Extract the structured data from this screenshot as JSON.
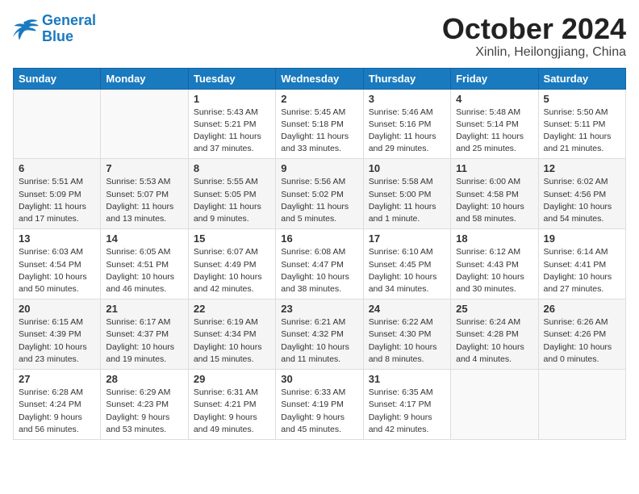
{
  "header": {
    "logo_line1": "General",
    "logo_line2": "Blue",
    "month": "October 2024",
    "location": "Xinlin, Heilongjiang, China"
  },
  "weekdays": [
    "Sunday",
    "Monday",
    "Tuesday",
    "Wednesday",
    "Thursday",
    "Friday",
    "Saturday"
  ],
  "weeks": [
    [
      {
        "day": "",
        "sunrise": "",
        "sunset": "",
        "daylight": ""
      },
      {
        "day": "",
        "sunrise": "",
        "sunset": "",
        "daylight": ""
      },
      {
        "day": "1",
        "sunrise": "Sunrise: 5:43 AM",
        "sunset": "Sunset: 5:21 PM",
        "daylight": "Daylight: 11 hours and 37 minutes."
      },
      {
        "day": "2",
        "sunrise": "Sunrise: 5:45 AM",
        "sunset": "Sunset: 5:18 PM",
        "daylight": "Daylight: 11 hours and 33 minutes."
      },
      {
        "day": "3",
        "sunrise": "Sunrise: 5:46 AM",
        "sunset": "Sunset: 5:16 PM",
        "daylight": "Daylight: 11 hours and 29 minutes."
      },
      {
        "day": "4",
        "sunrise": "Sunrise: 5:48 AM",
        "sunset": "Sunset: 5:14 PM",
        "daylight": "Daylight: 11 hours and 25 minutes."
      },
      {
        "day": "5",
        "sunrise": "Sunrise: 5:50 AM",
        "sunset": "Sunset: 5:11 PM",
        "daylight": "Daylight: 11 hours and 21 minutes."
      }
    ],
    [
      {
        "day": "6",
        "sunrise": "Sunrise: 5:51 AM",
        "sunset": "Sunset: 5:09 PM",
        "daylight": "Daylight: 11 hours and 17 minutes."
      },
      {
        "day": "7",
        "sunrise": "Sunrise: 5:53 AM",
        "sunset": "Sunset: 5:07 PM",
        "daylight": "Daylight: 11 hours and 13 minutes."
      },
      {
        "day": "8",
        "sunrise": "Sunrise: 5:55 AM",
        "sunset": "Sunset: 5:05 PM",
        "daylight": "Daylight: 11 hours and 9 minutes."
      },
      {
        "day": "9",
        "sunrise": "Sunrise: 5:56 AM",
        "sunset": "Sunset: 5:02 PM",
        "daylight": "Daylight: 11 hours and 5 minutes."
      },
      {
        "day": "10",
        "sunrise": "Sunrise: 5:58 AM",
        "sunset": "Sunset: 5:00 PM",
        "daylight": "Daylight: 11 hours and 1 minute."
      },
      {
        "day": "11",
        "sunrise": "Sunrise: 6:00 AM",
        "sunset": "Sunset: 4:58 PM",
        "daylight": "Daylight: 10 hours and 58 minutes."
      },
      {
        "day": "12",
        "sunrise": "Sunrise: 6:02 AM",
        "sunset": "Sunset: 4:56 PM",
        "daylight": "Daylight: 10 hours and 54 minutes."
      }
    ],
    [
      {
        "day": "13",
        "sunrise": "Sunrise: 6:03 AM",
        "sunset": "Sunset: 4:54 PM",
        "daylight": "Daylight: 10 hours and 50 minutes."
      },
      {
        "day": "14",
        "sunrise": "Sunrise: 6:05 AM",
        "sunset": "Sunset: 4:51 PM",
        "daylight": "Daylight: 10 hours and 46 minutes."
      },
      {
        "day": "15",
        "sunrise": "Sunrise: 6:07 AM",
        "sunset": "Sunset: 4:49 PM",
        "daylight": "Daylight: 10 hours and 42 minutes."
      },
      {
        "day": "16",
        "sunrise": "Sunrise: 6:08 AM",
        "sunset": "Sunset: 4:47 PM",
        "daylight": "Daylight: 10 hours and 38 minutes."
      },
      {
        "day": "17",
        "sunrise": "Sunrise: 6:10 AM",
        "sunset": "Sunset: 4:45 PM",
        "daylight": "Daylight: 10 hours and 34 minutes."
      },
      {
        "day": "18",
        "sunrise": "Sunrise: 6:12 AM",
        "sunset": "Sunset: 4:43 PM",
        "daylight": "Daylight: 10 hours and 30 minutes."
      },
      {
        "day": "19",
        "sunrise": "Sunrise: 6:14 AM",
        "sunset": "Sunset: 4:41 PM",
        "daylight": "Daylight: 10 hours and 27 minutes."
      }
    ],
    [
      {
        "day": "20",
        "sunrise": "Sunrise: 6:15 AM",
        "sunset": "Sunset: 4:39 PM",
        "daylight": "Daylight: 10 hours and 23 minutes."
      },
      {
        "day": "21",
        "sunrise": "Sunrise: 6:17 AM",
        "sunset": "Sunset: 4:37 PM",
        "daylight": "Daylight: 10 hours and 19 minutes."
      },
      {
        "day": "22",
        "sunrise": "Sunrise: 6:19 AM",
        "sunset": "Sunset: 4:34 PM",
        "daylight": "Daylight: 10 hours and 15 minutes."
      },
      {
        "day": "23",
        "sunrise": "Sunrise: 6:21 AM",
        "sunset": "Sunset: 4:32 PM",
        "daylight": "Daylight: 10 hours and 11 minutes."
      },
      {
        "day": "24",
        "sunrise": "Sunrise: 6:22 AM",
        "sunset": "Sunset: 4:30 PM",
        "daylight": "Daylight: 10 hours and 8 minutes."
      },
      {
        "day": "25",
        "sunrise": "Sunrise: 6:24 AM",
        "sunset": "Sunset: 4:28 PM",
        "daylight": "Daylight: 10 hours and 4 minutes."
      },
      {
        "day": "26",
        "sunrise": "Sunrise: 6:26 AM",
        "sunset": "Sunset: 4:26 PM",
        "daylight": "Daylight: 10 hours and 0 minutes."
      }
    ],
    [
      {
        "day": "27",
        "sunrise": "Sunrise: 6:28 AM",
        "sunset": "Sunset: 4:24 PM",
        "daylight": "Daylight: 9 hours and 56 minutes."
      },
      {
        "day": "28",
        "sunrise": "Sunrise: 6:29 AM",
        "sunset": "Sunset: 4:23 PM",
        "daylight": "Daylight: 9 hours and 53 minutes."
      },
      {
        "day": "29",
        "sunrise": "Sunrise: 6:31 AM",
        "sunset": "Sunset: 4:21 PM",
        "daylight": "Daylight: 9 hours and 49 minutes."
      },
      {
        "day": "30",
        "sunrise": "Sunrise: 6:33 AM",
        "sunset": "Sunset: 4:19 PM",
        "daylight": "Daylight: 9 hours and 45 minutes."
      },
      {
        "day": "31",
        "sunrise": "Sunrise: 6:35 AM",
        "sunset": "Sunset: 4:17 PM",
        "daylight": "Daylight: 9 hours and 42 minutes."
      },
      {
        "day": "",
        "sunrise": "",
        "sunset": "",
        "daylight": ""
      },
      {
        "day": "",
        "sunrise": "",
        "sunset": "",
        "daylight": ""
      }
    ]
  ]
}
